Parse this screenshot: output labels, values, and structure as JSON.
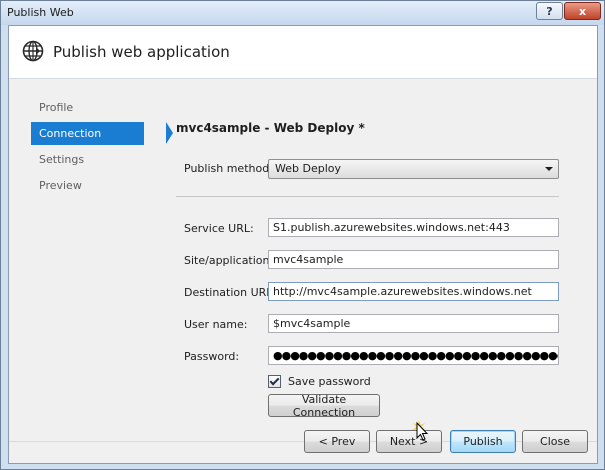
{
  "window": {
    "title": "Publish Web",
    "help_glyph": "?",
    "close_glyph": "x"
  },
  "header": {
    "title": "Publish web application",
    "icon": "globe-publish-icon"
  },
  "nav": {
    "items": [
      {
        "label": "Profile",
        "active": false
      },
      {
        "label": "Connection",
        "active": true
      },
      {
        "label": "Settings",
        "active": false
      },
      {
        "label": "Preview",
        "active": false
      }
    ]
  },
  "form": {
    "profile_heading": "mvc4sample - Web Deploy *",
    "publish_method": {
      "label": "Publish method:",
      "value": "Web Deploy"
    },
    "service_url": {
      "label": "Service URL:",
      "value": "S1.publish.azurewebsites.windows.net:443"
    },
    "site_application": {
      "label": "Site/application:",
      "value": "mvc4sample"
    },
    "destination_url": {
      "label": "Destination URL:",
      "value": "http://mvc4sample.azurewebsites.windows.net"
    },
    "user_name": {
      "label": "User name:",
      "value": "$mvc4sample"
    },
    "password": {
      "label": "Password:",
      "masked": "●●●●●●●●●●●●●●●●●●●●●●●●●●●●●●●●●●●●●●●●●●●●●●●●●●●●●●●●●●●●●●●"
    },
    "save_password": {
      "label": "Save password",
      "checked": true
    },
    "validate_label": "Validate Connection"
  },
  "footer": {
    "prev_label": "< Prev",
    "next_label": "Next >",
    "publish_label": "Publish",
    "close_label": "Close"
  },
  "colors": {
    "accent": "#1a7dd1",
    "title_bar": "#c6d8ee",
    "close_button": "#c0432a"
  }
}
